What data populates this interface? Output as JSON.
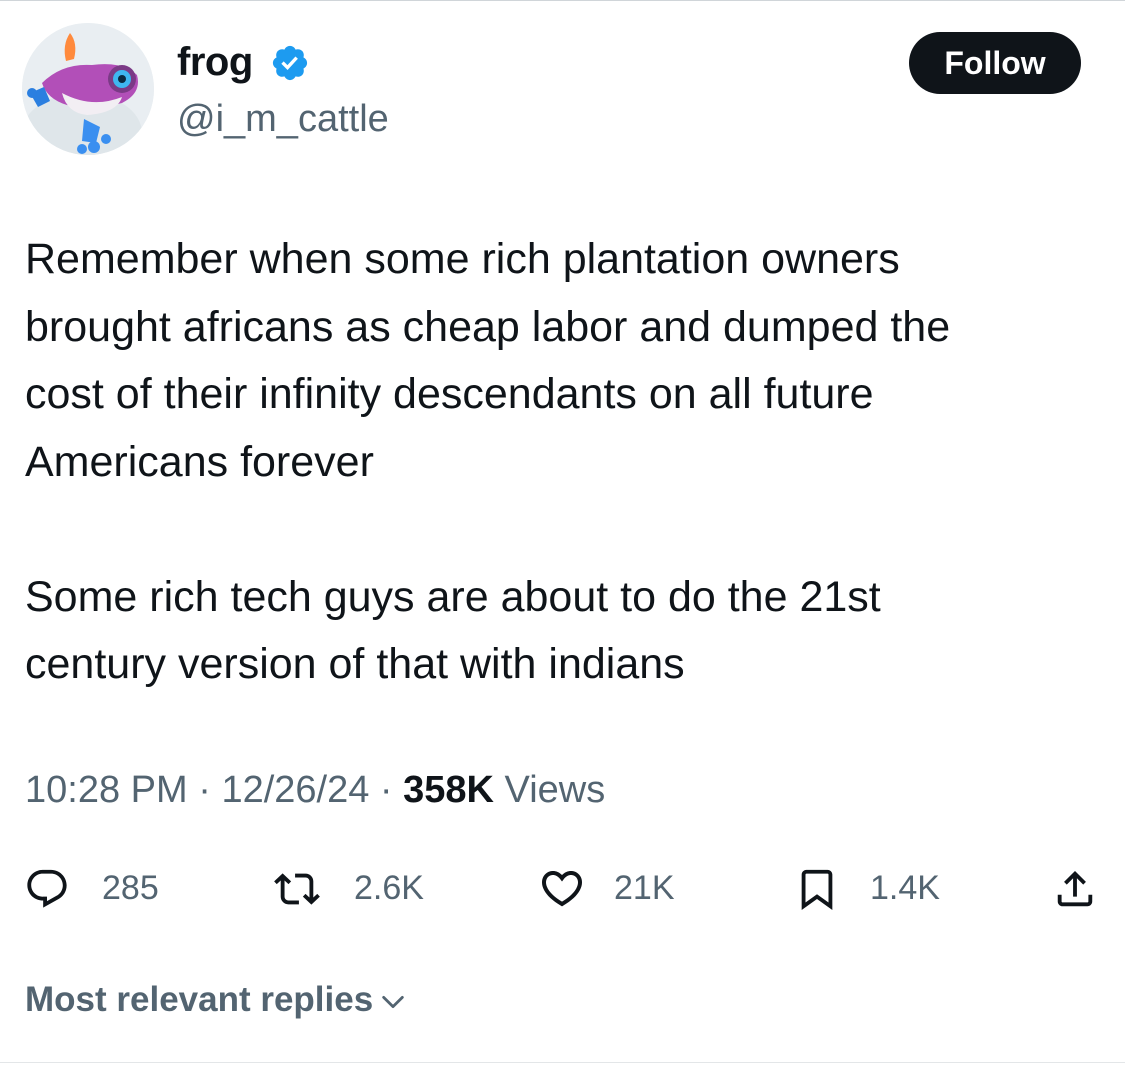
{
  "author": {
    "display_name": "frog",
    "handle": "@i_m_cattle",
    "verified_icon": "verified-badge-icon",
    "avatar_icon": "frog-avatar"
  },
  "follow_label": "Follow",
  "tweet": {
    "paragraph1": [
      "Remember when some rich plantation owners",
      "brought africans as cheap labor and dumped the",
      "cost of their infinity descendants on all future",
      "Americans forever"
    ],
    "paragraph2": [
      "Some rich tech guys are about to do the 21st",
      "century version of that with indians"
    ]
  },
  "meta": {
    "time": "10:28 PM",
    "separator": "·",
    "date": "12/26/24",
    "views_count": "358K",
    "views_label": "Views"
  },
  "actions": {
    "reply": {
      "icon": "reply-icon",
      "count": "285"
    },
    "repost": {
      "icon": "repost-icon",
      "count": "2.6K"
    },
    "like": {
      "icon": "heart-icon",
      "count": "21K"
    },
    "bookmark": {
      "icon": "bookmark-icon",
      "count": "1.4K"
    },
    "share": {
      "icon": "share-icon"
    }
  },
  "replies_sort_label": "Most relevant replies",
  "colors": {
    "text": "#0f1419",
    "secondary": "#536471",
    "verified": "#1d9bf0",
    "button_bg": "#0f1419"
  }
}
